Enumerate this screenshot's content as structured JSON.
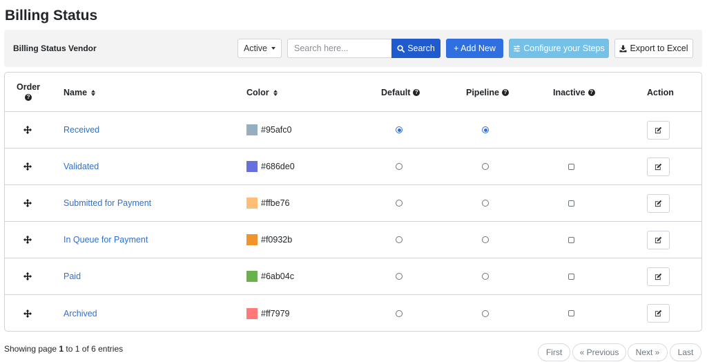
{
  "page": {
    "title": "Billing Status"
  },
  "toolbar": {
    "title": "Billing Status Vendor",
    "status_filter": "Active",
    "search_placeholder": "Search here...",
    "search_label": "Search",
    "add_label": "+ Add New",
    "configure_label": "Configure your Steps",
    "export_label": "Export to Excel"
  },
  "table": {
    "headers": {
      "order": "Order",
      "name": "Name",
      "color": "Color",
      "default": "Default",
      "pipeline": "Pipeline",
      "inactive": "Inactive",
      "action": "Action"
    },
    "rows": [
      {
        "name": "Received",
        "color": "#95afc0",
        "default": true,
        "pipeline": true,
        "inactive": null
      },
      {
        "name": "Validated",
        "color": "#686de0",
        "default": false,
        "pipeline": false,
        "inactive": false
      },
      {
        "name": "Submitted for Payment",
        "color": "#ffbe76",
        "default": false,
        "pipeline": false,
        "inactive": false
      },
      {
        "name": "In Queue for Payment",
        "color": "#f0932b",
        "default": false,
        "pipeline": false,
        "inactive": false
      },
      {
        "name": "Paid",
        "color": "#6ab04c",
        "default": false,
        "pipeline": false,
        "inactive": false
      },
      {
        "name": "Archived",
        "color": "#ff7979",
        "default": false,
        "pipeline": false,
        "inactive": false
      }
    ]
  },
  "footer": {
    "info_prefix": "Showing page ",
    "page_from": "1",
    "info_mid": " to 1 of 6 entries",
    "first": "First",
    "previous": "« Previous",
    "next": "Next »",
    "last": "Last"
  },
  "colors": {
    "primary": "#2f6fe0",
    "search_button": "#1f5bcd",
    "configure_button": "#74c0e6",
    "link": "#2e6fd3"
  },
  "icons": {
    "search": "search-icon",
    "configure": "sliders-icon",
    "export": "download-icon",
    "drag": "move-arrows-icon",
    "edit": "edit-icon",
    "help": "question-circle-icon",
    "sort": "sort-icon"
  }
}
